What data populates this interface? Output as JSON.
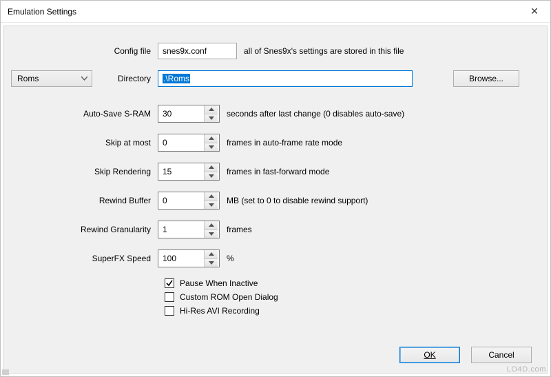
{
  "window": {
    "title": "Emulation Settings",
    "close_glyph": "✕"
  },
  "config": {
    "label": "Config file",
    "value": "snes9x.conf",
    "desc": "all of Snes9x's settings are stored in this file"
  },
  "dir_type": {
    "selected": "Roms"
  },
  "directory": {
    "label": "Directory",
    "value": ".\\Roms",
    "browse_label": "Browse..."
  },
  "rows": [
    {
      "label": "Auto-Save S-RAM",
      "value": "30",
      "desc": "seconds after last change (0 disables auto-save)"
    },
    {
      "label": "Skip at most",
      "value": "0",
      "desc": "frames in auto-frame rate mode"
    },
    {
      "label": "Skip Rendering",
      "value": "15",
      "desc": "frames in fast-forward mode"
    },
    {
      "label": "Rewind Buffer",
      "value": "0",
      "desc": "MB (set to 0 to disable rewind support)"
    },
    {
      "label": "Rewind Granularity",
      "value": "1",
      "desc": "frames"
    },
    {
      "label": "SuperFX Speed",
      "value": "100",
      "desc": "%"
    }
  ],
  "checks": {
    "pause": {
      "label": "Pause When Inactive",
      "checked": true
    },
    "custom": {
      "label": "Custom ROM Open Dialog",
      "checked": false
    },
    "hires": {
      "label": "Hi-Res AVI Recording",
      "checked": false
    }
  },
  "buttons": {
    "ok": "OK",
    "cancel": "Cancel"
  },
  "watermark": "LO4D.com"
}
